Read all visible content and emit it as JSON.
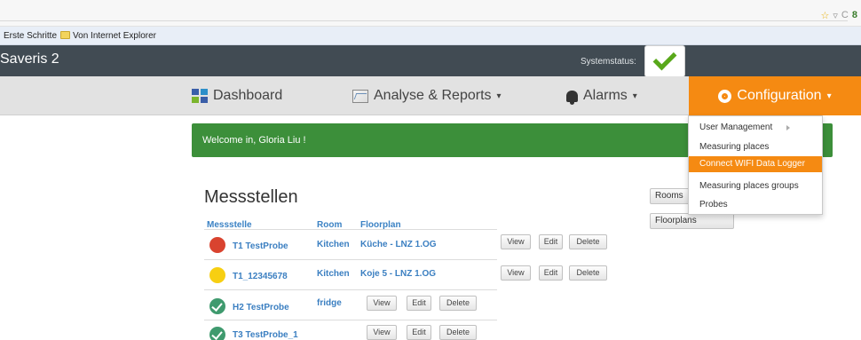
{
  "browser": {
    "bookmarks": [
      {
        "label": "Erste Schritte"
      },
      {
        "label": "Von Internet Explorer"
      }
    ]
  },
  "header": {
    "app_title": "Saveris 2",
    "system_status_label": "Systemstatus:"
  },
  "navbar": {
    "dashboard": "Dashboard",
    "analyse": "Analyse & Reports",
    "alarms": "Alarms",
    "configuration": "Configuration"
  },
  "welcome": "Welcome in, Gloria Liu !",
  "config_menu": {
    "items": [
      {
        "label": "User Management"
      },
      {
        "label": "Measuring places"
      },
      {
        "label": "Connect WIFI Data Logger"
      },
      {
        "label": "Measuring places groups"
      },
      {
        "label": "Probes"
      }
    ]
  },
  "main": {
    "title": "Messstellen",
    "columns": [
      "Messstelle",
      "Room",
      "Floorplan"
    ],
    "rows": [
      {
        "name": "T1 TestProbe",
        "room": "Kitchen",
        "floorplan": "Küche - LNZ 1.OG",
        "status": "red"
      },
      {
        "name": "T1_12345678",
        "room": "Kitchen",
        "floorplan": "Koje 5 - LNZ 1.OG",
        "status": "yellow"
      },
      {
        "name": "H2 TestProbe",
        "room": "fridge",
        "floorplan": "",
        "status": "green"
      },
      {
        "name": "T3 TestProbe_1",
        "room": "",
        "floorplan": "",
        "status": "green"
      }
    ],
    "actions": {
      "view": "View",
      "edit": "Edit",
      "delete": "Delete"
    },
    "side_buttons": {
      "rooms": "Rooms",
      "floorplans": "Floorplans"
    }
  },
  "colors": {
    "header_bg": "#414b53",
    "accent_orange": "#f58a12",
    "welcome_green": "#3c8f3a",
    "link_blue": "#3b7fc1"
  }
}
